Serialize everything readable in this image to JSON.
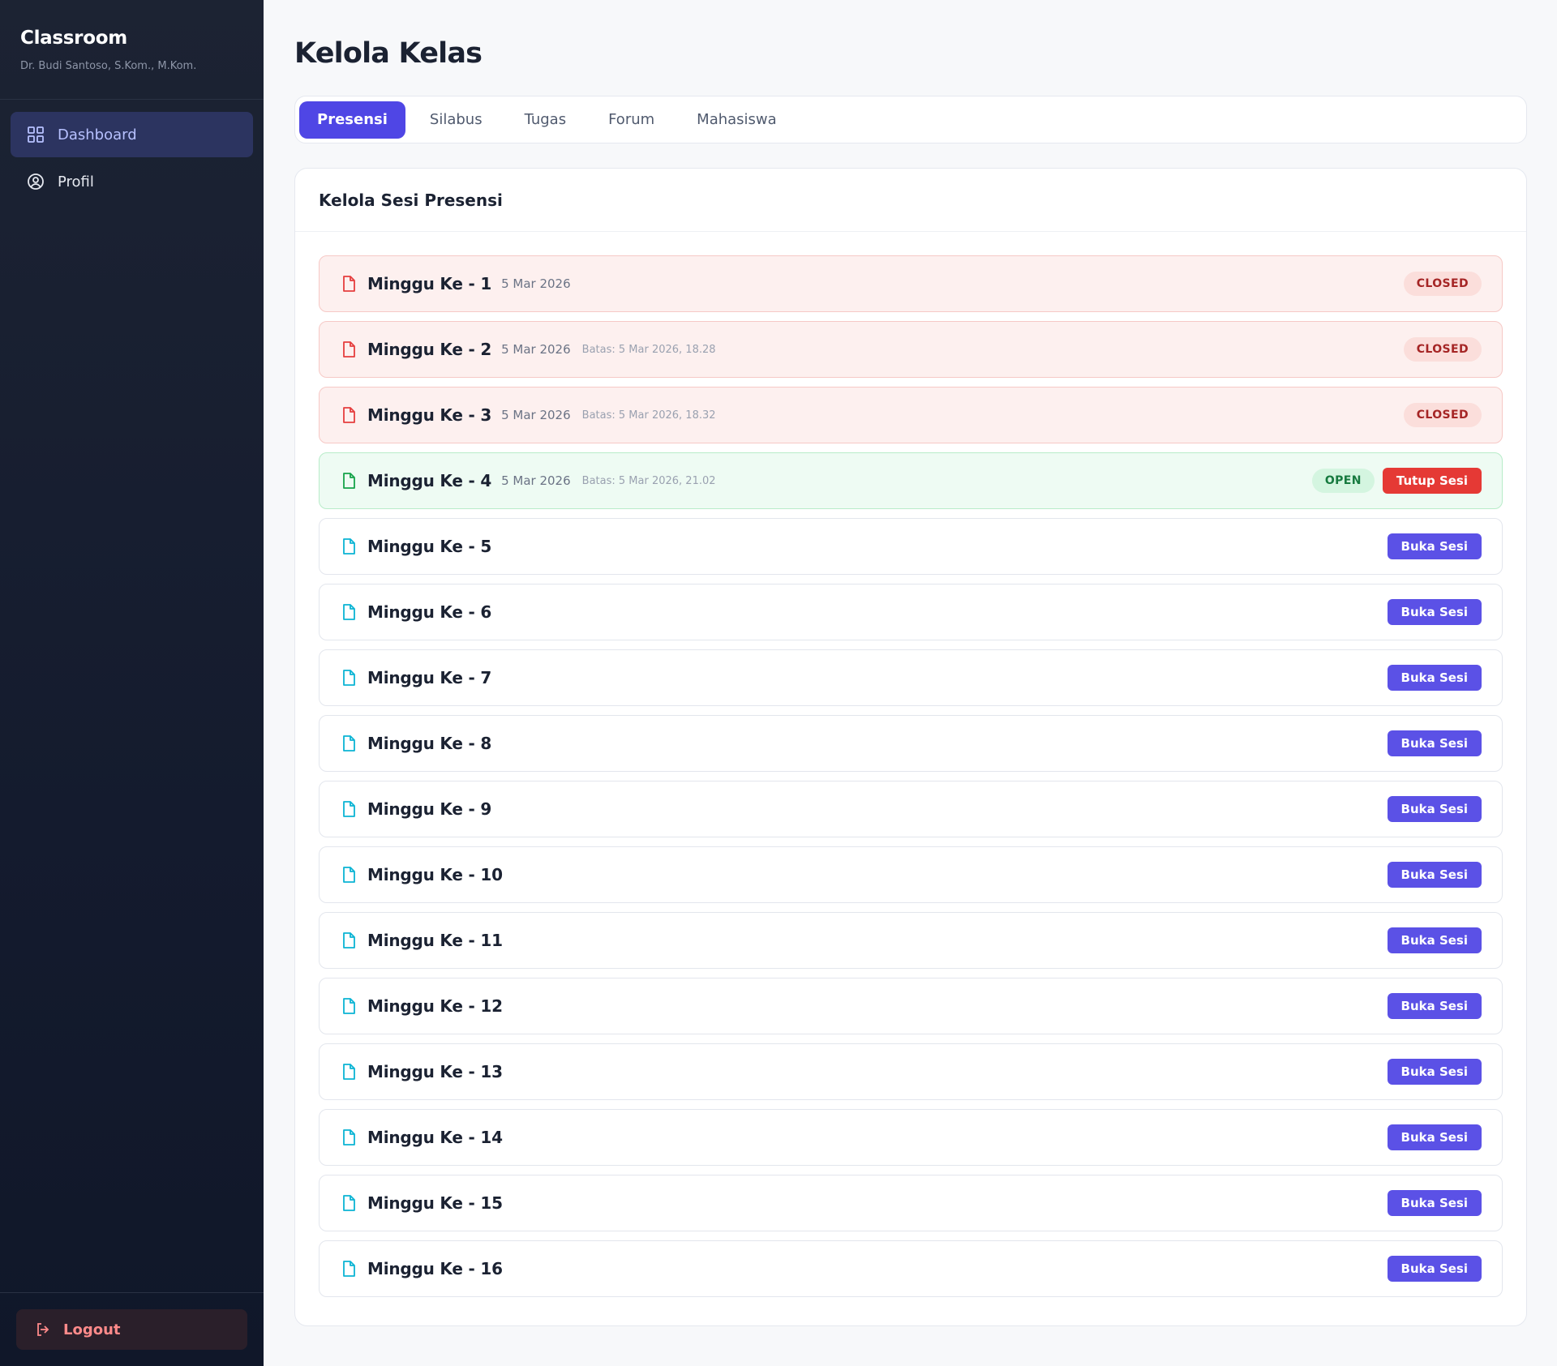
{
  "app": {
    "name": "Classroom",
    "user": "Dr. Budi Santoso, S.Kom., M.Kom."
  },
  "sidebar": {
    "items": [
      {
        "label": "Dashboard",
        "icon": "grid-icon"
      },
      {
        "label": "Profil",
        "icon": "user-circle-icon"
      }
    ],
    "logout": "Logout"
  },
  "page": {
    "title": "Kelola Kelas"
  },
  "tabs": [
    {
      "label": "Presensi"
    },
    {
      "label": "Silabus"
    },
    {
      "label": "Tugas"
    },
    {
      "label": "Forum"
    },
    {
      "label": "Mahasiswa"
    }
  ],
  "card": {
    "title": "Kelola Sesi Presensi"
  },
  "sessions": [
    {
      "name": "Minggu Ke - 1",
      "date": "5 Mar 2026",
      "deadline": "",
      "status": "closed",
      "badge": "CLOSED",
      "action": ""
    },
    {
      "name": "Minggu Ke - 2",
      "date": "5 Mar 2026",
      "deadline": "Batas: 5 Mar 2026, 18.28",
      "status": "closed",
      "badge": "CLOSED",
      "action": ""
    },
    {
      "name": "Minggu Ke - 3",
      "date": "5 Mar 2026",
      "deadline": "Batas: 5 Mar 2026, 18.32",
      "status": "closed",
      "badge": "CLOSED",
      "action": ""
    },
    {
      "name": "Minggu Ke - 4",
      "date": "5 Mar 2026",
      "deadline": "Batas: 5 Mar 2026, 21.02",
      "status": "open",
      "badge": "OPEN",
      "action": "Tutup Sesi"
    },
    {
      "name": "Minggu Ke - 5",
      "date": "",
      "deadline": "",
      "status": "none",
      "badge": "",
      "action": "Buka Sesi"
    },
    {
      "name": "Minggu Ke - 6",
      "date": "",
      "deadline": "",
      "status": "none",
      "badge": "",
      "action": "Buka Sesi"
    },
    {
      "name": "Minggu Ke - 7",
      "date": "",
      "deadline": "",
      "status": "none",
      "badge": "",
      "action": "Buka Sesi"
    },
    {
      "name": "Minggu Ke - 8",
      "date": "",
      "deadline": "",
      "status": "none",
      "badge": "",
      "action": "Buka Sesi"
    },
    {
      "name": "Minggu Ke - 9",
      "date": "",
      "deadline": "",
      "status": "none",
      "badge": "",
      "action": "Buka Sesi"
    },
    {
      "name": "Minggu Ke - 10",
      "date": "",
      "deadline": "",
      "status": "none",
      "badge": "",
      "action": "Buka Sesi"
    },
    {
      "name": "Minggu Ke - 11",
      "date": "",
      "deadline": "",
      "status": "none",
      "badge": "",
      "action": "Buka Sesi"
    },
    {
      "name": "Minggu Ke - 12",
      "date": "",
      "deadline": "",
      "status": "none",
      "badge": "",
      "action": "Buka Sesi"
    },
    {
      "name": "Minggu Ke - 13",
      "date": "",
      "deadline": "",
      "status": "none",
      "badge": "",
      "action": "Buka Sesi"
    },
    {
      "name": "Minggu Ke - 14",
      "date": "",
      "deadline": "",
      "status": "none",
      "badge": "",
      "action": "Buka Sesi"
    },
    {
      "name": "Minggu Ke - 15",
      "date": "",
      "deadline": "",
      "status": "none",
      "badge": "",
      "action": "Buka Sesi"
    },
    {
      "name": "Minggu Ke - 16",
      "date": "",
      "deadline": "",
      "status": "none",
      "badge": "",
      "action": "Buka Sesi"
    }
  ],
  "colors": {
    "accent": "#4f46e5",
    "closed": "#e53e3e",
    "open": "#16a34a",
    "file_default": "#0bb4d4",
    "danger": "#e53935"
  }
}
